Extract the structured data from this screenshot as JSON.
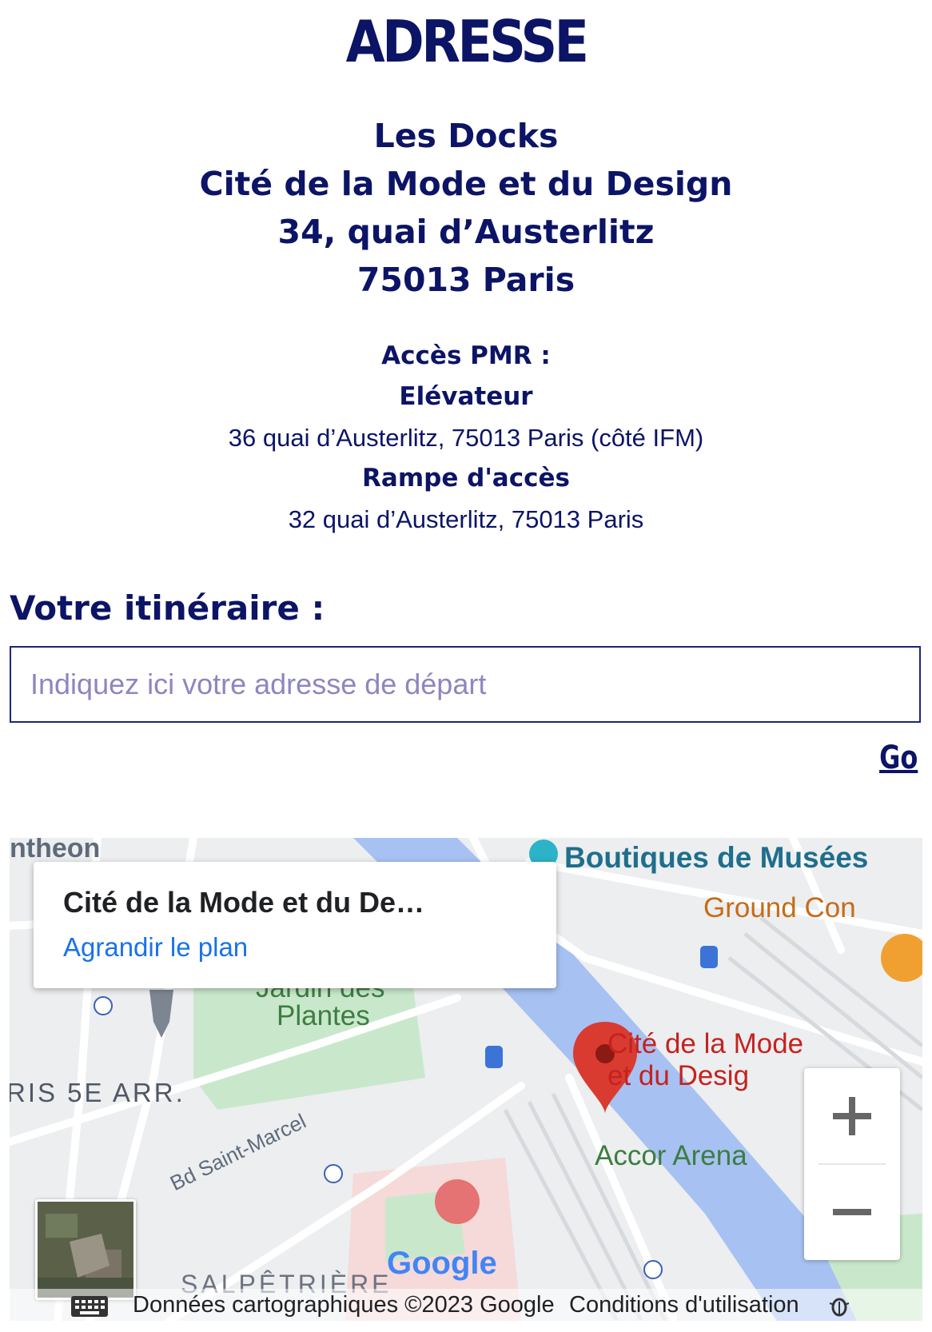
{
  "page_title": "ADRESSE",
  "address": {
    "line1": "Les Docks",
    "line2": "Cité de la Mode et du Design",
    "line3": "34, quai d’Austerlitz",
    "line4": "75013 Paris"
  },
  "pmr": {
    "heading": "Accès PMR :",
    "elevator_label": "Elévateur",
    "elevator_address": "36 quai d’Austerlitz, 75013 Paris (côté IFM)",
    "ramp_label": "Rampe d'accès",
    "ramp_address": "32 quai d’Austerlitz, 75013 Paris"
  },
  "itinerary": {
    "title": "Votre itinéraire :",
    "placeholder": "Indiquez ici votre adresse de départ",
    "go_label": "Go"
  },
  "map": {
    "info_card": {
      "title": "Cité de la Mode et du De…",
      "link": "Agrandir le plan"
    },
    "labels": {
      "pantheon": "ntheon",
      "boutiques": "Boutiques de Musées",
      "ground": "Ground Con",
      "jardin1": "Jardin des",
      "jardin2": "Plantes",
      "arr": "RIS 5E ARR.",
      "cite1": "Cité de la Mode",
      "cite2": "et du Desig",
      "accor": "Accor Arena",
      "bd": "Bd Saint-Marcel",
      "salpe": "SALPÊTRIÈRE",
      "google": "Google"
    },
    "footer": {
      "data": "Données cartographiques ©2023 Google",
      "terms": "Conditions d'utilisation"
    },
    "colors": {
      "water": "#a7c1f2",
      "park": "#c9e8cb",
      "marker": "#d93b30",
      "label_blue": "#1f6e8c",
      "label_red": "#c5221f"
    }
  }
}
